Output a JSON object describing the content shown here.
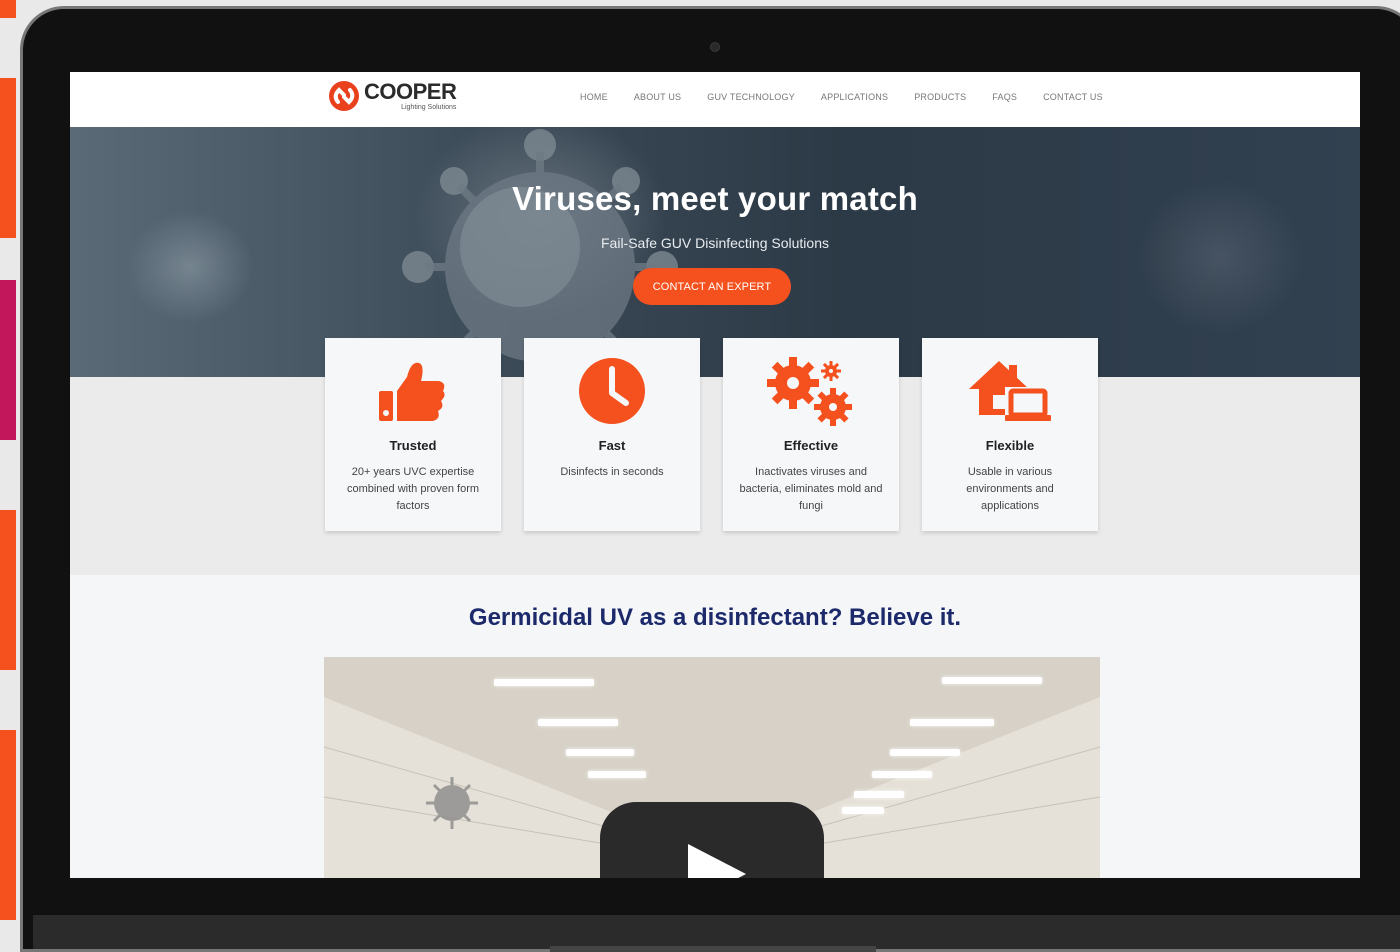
{
  "brand": {
    "name": "COOPER",
    "tagline": "Lighting Solutions",
    "accent_color": "#f4511e",
    "heading_color": "#1c2a6b"
  },
  "nav": {
    "items": [
      "HOME",
      "ABOUT US",
      "GUV TECHNOLOGY",
      "APPLICATIONS",
      "PRODUCTS",
      "FAQS",
      "CONTACT US"
    ]
  },
  "hero": {
    "title": "Viruses, meet your match",
    "subtitle": "Fail-Safe GUV Disinfecting Solutions",
    "cta_label": "CONTACT AN EXPERT"
  },
  "features": [
    {
      "icon": "thumbs-up-icon",
      "title": "Trusted",
      "desc": "20+ years UVC expertise combined with proven form factors"
    },
    {
      "icon": "clock-icon",
      "title": "Fast",
      "desc": "Disinfects in seconds"
    },
    {
      "icon": "gears-icon",
      "title": "Effective",
      "desc": "Inactivates viruses and bacteria, eliminates mold and fungi"
    },
    {
      "icon": "home-laptop-icon",
      "title": "Flexible",
      "desc": "Usable in various environments and applications"
    }
  ],
  "section": {
    "title": "Germicidal UV as a disinfectant? Believe it."
  },
  "video": {
    "icon": "play-icon"
  }
}
